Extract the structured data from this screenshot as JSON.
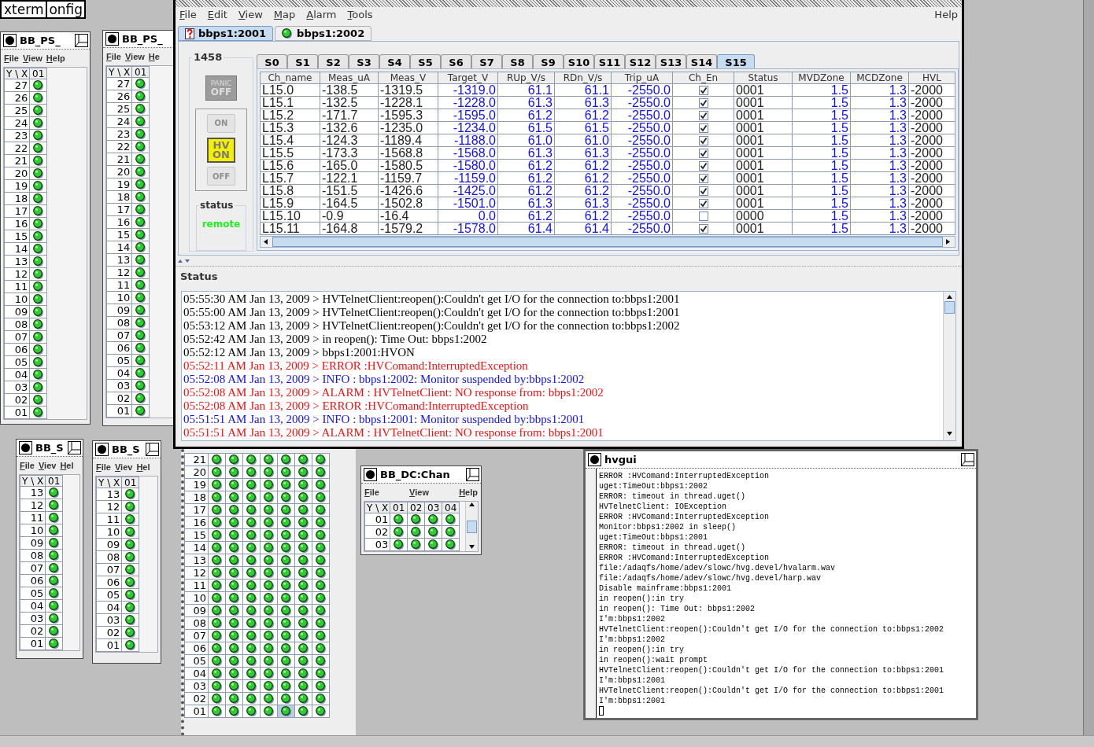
{
  "desktop_labels": [
    "xterm",
    "onfig"
  ],
  "grid_windows": [
    {
      "title": "BB_PS_",
      "menu": [
        "File",
        "View",
        "Help"
      ],
      "corner": "Y \\ X",
      "columns": [
        "01"
      ],
      "rows": [
        {
          "label": "27",
          "lit": [
            true
          ]
        },
        {
          "label": "26",
          "lit": [
            true
          ]
        },
        {
          "label": "25",
          "lit": [
            true
          ]
        },
        {
          "label": "24",
          "lit": [
            true
          ]
        },
        {
          "label": "23",
          "lit": [
            true
          ]
        },
        {
          "label": "22",
          "lit": [
            true
          ]
        },
        {
          "label": "21",
          "lit": [
            true
          ]
        },
        {
          "label": "20",
          "lit": [
            true
          ]
        },
        {
          "label": "19",
          "lit": [
            true
          ]
        },
        {
          "label": "18",
          "lit": [
            true
          ]
        },
        {
          "label": "17",
          "lit": [
            true
          ]
        },
        {
          "label": "16",
          "lit": [
            true
          ]
        },
        {
          "label": "15",
          "lit": [
            true
          ]
        },
        {
          "label": "14",
          "lit": [
            true
          ]
        },
        {
          "label": "13",
          "lit": [
            true
          ]
        },
        {
          "label": "12",
          "lit": [
            true
          ]
        },
        {
          "label": "11",
          "lit": [
            true
          ]
        },
        {
          "label": "10",
          "lit": [
            true
          ]
        },
        {
          "label": "09",
          "lit": [
            true
          ]
        },
        {
          "label": "08",
          "lit": [
            true
          ]
        },
        {
          "label": "07",
          "lit": [
            true
          ]
        },
        {
          "label": "06",
          "lit": [
            true
          ]
        },
        {
          "label": "05",
          "lit": [
            true
          ]
        },
        {
          "label": "04",
          "lit": [
            true
          ]
        },
        {
          "label": "03",
          "lit": [
            true
          ]
        },
        {
          "label": "02",
          "lit": [
            true
          ]
        },
        {
          "label": "01",
          "lit": [
            true
          ]
        }
      ]
    },
    {
      "title": "BB_PS_",
      "menu": [
        "File",
        "View",
        "He"
      ],
      "corner": "Y \\ X",
      "columns": [
        "01"
      ],
      "rows": [
        {
          "label": "27",
          "lit": [
            true
          ]
        },
        {
          "label": "26",
          "lit": [
            true
          ]
        },
        {
          "label": "25",
          "lit": [
            true
          ]
        },
        {
          "label": "24",
          "lit": [
            true
          ]
        },
        {
          "label": "23",
          "lit": [
            true
          ]
        },
        {
          "label": "22",
          "lit": [
            true
          ]
        },
        {
          "label": "21",
          "lit": [
            true
          ]
        },
        {
          "label": "20",
          "lit": [
            true
          ]
        },
        {
          "label": "19",
          "lit": [
            true
          ]
        },
        {
          "label": "18",
          "lit": [
            true
          ]
        },
        {
          "label": "17",
          "lit": [
            true
          ]
        },
        {
          "label": "16",
          "lit": [
            true
          ]
        },
        {
          "label": "15",
          "lit": [
            true
          ]
        },
        {
          "label": "14",
          "lit": [
            true
          ]
        },
        {
          "label": "13",
          "lit": [
            true
          ]
        },
        {
          "label": "12",
          "lit": [
            true
          ]
        },
        {
          "label": "11",
          "lit": [
            true
          ]
        },
        {
          "label": "10",
          "lit": [
            true
          ]
        },
        {
          "label": "09",
          "lit": [
            true
          ]
        },
        {
          "label": "08",
          "lit": [
            true
          ]
        },
        {
          "label": "07",
          "lit": [
            true
          ]
        },
        {
          "label": "06",
          "lit": [
            true
          ]
        },
        {
          "label": "05",
          "lit": [
            true
          ]
        },
        {
          "label": "04",
          "lit": [
            true
          ]
        },
        {
          "label": "03",
          "lit": [
            true
          ]
        },
        {
          "label": "02",
          "lit": [
            true
          ]
        },
        {
          "label": "01",
          "lit": [
            true
          ]
        }
      ]
    },
    {
      "title": "BB_S",
      "menu": [
        "File",
        "Viev",
        "Hel"
      ],
      "corner": "Y \\ X",
      "columns": [
        "01"
      ],
      "rows": [
        {
          "label": "13",
          "lit": [
            true
          ]
        },
        {
          "label": "12",
          "lit": [
            true
          ]
        },
        {
          "label": "11",
          "lit": [
            true
          ]
        },
        {
          "label": "10",
          "lit": [
            true
          ]
        },
        {
          "label": "09",
          "lit": [
            true
          ]
        },
        {
          "label": "08",
          "lit": [
            true
          ]
        },
        {
          "label": "07",
          "lit": [
            true
          ]
        },
        {
          "label": "06",
          "lit": [
            true
          ]
        },
        {
          "label": "05",
          "lit": [
            true
          ]
        },
        {
          "label": "04",
          "lit": [
            true
          ]
        },
        {
          "label": "03",
          "lit": [
            true
          ]
        },
        {
          "label": "02",
          "lit": [
            true
          ]
        },
        {
          "label": "01",
          "lit": [
            true
          ]
        }
      ]
    },
    {
      "title": "BB_S",
      "menu": [
        "File",
        "Viev",
        "Hel"
      ],
      "corner": "Y \\ X",
      "columns": [
        "01"
      ],
      "rows": [
        {
          "label": "13",
          "lit": [
            true
          ]
        },
        {
          "label": "12",
          "lit": [
            true
          ]
        },
        {
          "label": "11",
          "lit": [
            true
          ]
        },
        {
          "label": "10",
          "lit": [
            true
          ]
        },
        {
          "label": "09",
          "lit": [
            true
          ]
        },
        {
          "label": "08",
          "lit": [
            true
          ]
        },
        {
          "label": "07",
          "lit": [
            true
          ]
        },
        {
          "label": "06",
          "lit": [
            true
          ]
        },
        {
          "label": "05",
          "lit": [
            true
          ]
        },
        {
          "label": "04",
          "lit": [
            true
          ]
        },
        {
          "label": "03",
          "lit": [
            true
          ]
        },
        {
          "label": "02",
          "lit": [
            true
          ]
        },
        {
          "label": "01",
          "lit": [
            true
          ]
        }
      ]
    },
    {
      "title": "BB_DC:Chan",
      "menu": [
        "File",
        "View",
        "Help"
      ],
      "corner": "Y \\ X",
      "columns": [
        "01",
        "02",
        "03",
        "04"
      ],
      "rows": [
        {
          "label": "01",
          "lit": [
            true,
            true,
            true,
            true
          ]
        },
        {
          "label": "02",
          "lit": [
            true,
            true,
            true,
            true
          ]
        },
        {
          "label": "03",
          "lit": [
            true,
            true,
            true,
            true
          ]
        }
      ]
    }
  ],
  "big_grid": {
    "rows": [
      {
        "label": "21",
        "lit": [
          true,
          true,
          true,
          true,
          true,
          true,
          true
        ],
        "selected": [
          false,
          false,
          false,
          false,
          false,
          false,
          false
        ]
      },
      {
        "label": "20",
        "lit": [
          true,
          true,
          true,
          true,
          true,
          true,
          true
        ],
        "selected": [
          false,
          false,
          false,
          false,
          false,
          false,
          false
        ]
      },
      {
        "label": "19",
        "lit": [
          true,
          true,
          true,
          true,
          true,
          true,
          true
        ],
        "selected": [
          false,
          false,
          false,
          false,
          false,
          false,
          false
        ]
      },
      {
        "label": "18",
        "lit": [
          true,
          true,
          true,
          true,
          true,
          true,
          true
        ],
        "selected": [
          false,
          false,
          false,
          false,
          false,
          false,
          false
        ]
      },
      {
        "label": "17",
        "lit": [
          true,
          true,
          true,
          true,
          true,
          true,
          true
        ],
        "selected": [
          false,
          false,
          false,
          false,
          false,
          false,
          false
        ]
      },
      {
        "label": "16",
        "lit": [
          true,
          true,
          true,
          true,
          true,
          true,
          true
        ],
        "selected": [
          false,
          false,
          false,
          false,
          false,
          false,
          false
        ]
      },
      {
        "label": "15",
        "lit": [
          true,
          true,
          true,
          true,
          true,
          true,
          true
        ],
        "selected": [
          false,
          false,
          false,
          false,
          false,
          false,
          false
        ]
      },
      {
        "label": "14",
        "lit": [
          true,
          true,
          true,
          true,
          true,
          true,
          true
        ],
        "selected": [
          false,
          false,
          false,
          false,
          false,
          false,
          false
        ]
      },
      {
        "label": "13",
        "lit": [
          true,
          true,
          true,
          true,
          true,
          true,
          true
        ],
        "selected": [
          false,
          false,
          false,
          false,
          false,
          false,
          false
        ]
      },
      {
        "label": "12",
        "lit": [
          true,
          true,
          true,
          true,
          true,
          true,
          true
        ],
        "selected": [
          false,
          false,
          false,
          false,
          false,
          false,
          false
        ]
      },
      {
        "label": "11",
        "lit": [
          true,
          true,
          true,
          true,
          true,
          true,
          true
        ],
        "selected": [
          false,
          false,
          false,
          false,
          false,
          false,
          false
        ]
      },
      {
        "label": "10",
        "lit": [
          true,
          true,
          true,
          true,
          true,
          true,
          true
        ],
        "selected": [
          false,
          false,
          false,
          false,
          false,
          false,
          false
        ]
      },
      {
        "label": "09",
        "lit": [
          true,
          true,
          true,
          true,
          true,
          true,
          true
        ],
        "selected": [
          false,
          false,
          false,
          false,
          false,
          false,
          false
        ]
      },
      {
        "label": "08",
        "lit": [
          true,
          true,
          true,
          true,
          true,
          true,
          true
        ],
        "selected": [
          false,
          false,
          false,
          false,
          false,
          false,
          false
        ]
      },
      {
        "label": "07",
        "lit": [
          true,
          true,
          true,
          true,
          true,
          true,
          true
        ],
        "selected": [
          false,
          false,
          false,
          false,
          false,
          false,
          false
        ]
      },
      {
        "label": "06",
        "lit": [
          true,
          true,
          true,
          true,
          true,
          true,
          true
        ],
        "selected": [
          false,
          false,
          false,
          false,
          false,
          false,
          false
        ]
      },
      {
        "label": "05",
        "lit": [
          true,
          true,
          true,
          true,
          true,
          true,
          true
        ],
        "selected": [
          false,
          false,
          false,
          false,
          false,
          false,
          false
        ]
      },
      {
        "label": "04",
        "lit": [
          true,
          true,
          true,
          true,
          true,
          true,
          true
        ],
        "selected": [
          false,
          false,
          false,
          false,
          false,
          false,
          false
        ]
      },
      {
        "label": "03",
        "lit": [
          true,
          true,
          true,
          true,
          true,
          true,
          true
        ],
        "selected": [
          false,
          false,
          false,
          false,
          false,
          false,
          false
        ]
      },
      {
        "label": "02",
        "lit": [
          true,
          true,
          true,
          true,
          true,
          true,
          true
        ],
        "selected": [
          false,
          false,
          false,
          false,
          false,
          false,
          false
        ]
      },
      {
        "label": "01",
        "lit": [
          true,
          true,
          true,
          true,
          true,
          true,
          true
        ],
        "selected": [
          false,
          false,
          false,
          false,
          true,
          false,
          false
        ]
      }
    ]
  },
  "main": {
    "menu": [
      "File",
      "Edit",
      "View",
      "Map",
      "Alarm",
      "Tools"
    ],
    "menu_right": "Help",
    "crates": [
      {
        "label": "bbps1:2001",
        "kind": "question",
        "selected": true
      },
      {
        "label": "bbps1:2002",
        "kind": "led",
        "selected": false
      }
    ],
    "crate_panel": {
      "title": "1458",
      "panic": [
        "PANIC",
        "OFF"
      ],
      "on_button": {
        "label": "ON",
        "disabled": true
      },
      "hv_button": {
        "lines": [
          "HV",
          "ON"
        ],
        "active": true
      },
      "off_button": {
        "label": "OFF",
        "disabled": true
      },
      "status_title": "status",
      "status_value": "remote"
    },
    "slots": [
      {
        "label": "S0",
        "selected": false
      },
      {
        "label": "S1",
        "selected": false
      },
      {
        "label": "S2",
        "selected": false
      },
      {
        "label": "S3",
        "selected": false
      },
      {
        "label": "S4",
        "selected": false
      },
      {
        "label": "S5",
        "selected": false
      },
      {
        "label": "S6",
        "selected": false
      },
      {
        "label": "S7",
        "selected": false
      },
      {
        "label": "S8",
        "selected": false
      },
      {
        "label": "S9",
        "selected": false
      },
      {
        "label": "S10",
        "selected": false
      },
      {
        "label": "S11",
        "selected": false
      },
      {
        "label": "S12",
        "selected": false
      },
      {
        "label": "S13",
        "selected": false
      },
      {
        "label": "S14",
        "selected": false
      },
      {
        "label": "S15",
        "selected": true
      }
    ],
    "table": {
      "columns": [
        {
          "label": "Ch_name",
          "kind": "readonly"
        },
        {
          "label": "Meas_uA",
          "kind": "readonly"
        },
        {
          "label": "Meas_V",
          "kind": "readonly"
        },
        {
          "label": "Target_V",
          "kind": "editable"
        },
        {
          "label": "RUp_V/s",
          "kind": "editable"
        },
        {
          "label": "RDn_V/s",
          "kind": "editable"
        },
        {
          "label": "Trip_uA",
          "kind": "editable"
        },
        {
          "label": "Ch_En",
          "kind": "check"
        },
        {
          "label": "Status",
          "kind": "readonly"
        },
        {
          "label": "MVDZone",
          "kind": "editable"
        },
        {
          "label": "MCDZone",
          "kind": "editable"
        },
        {
          "label": "HVL",
          "kind": "readonly"
        }
      ],
      "rows": [
        {
          "cells": [
            "L15.0",
            "-138.5",
            "-1319.5",
            "-1319.0",
            "61.1",
            "61.1",
            "-2550.0",
            null,
            "0001",
            "1.5",
            "1.3",
            "-2000"
          ],
          "enabled": true
        },
        {
          "cells": [
            "L15.1",
            "-132.5",
            "-1228.1",
            "-1228.0",
            "61.3",
            "61.3",
            "-2550.0",
            null,
            "0001",
            "1.5",
            "1.3",
            "-2000"
          ],
          "enabled": true
        },
        {
          "cells": [
            "L15.2",
            "-171.7",
            "-1595.3",
            "-1595.0",
            "61.2",
            "61.2",
            "-2550.0",
            null,
            "0001",
            "1.5",
            "1.3",
            "-2000"
          ],
          "enabled": true
        },
        {
          "cells": [
            "L15.3",
            "-132.6",
            "-1235.0",
            "-1234.0",
            "61.5",
            "61.5",
            "-2550.0",
            null,
            "0001",
            "1.5",
            "1.3",
            "-2000"
          ],
          "enabled": true
        },
        {
          "cells": [
            "L15.4",
            "-124.3",
            "-1189.4",
            "-1188.0",
            "61.0",
            "61.0",
            "-2550.0",
            null,
            "0001",
            "1.5",
            "1.3",
            "-2000"
          ],
          "enabled": true
        },
        {
          "cells": [
            "L15.5",
            "-173.3",
            "-1568.8",
            "-1568.0",
            "61.3",
            "61.3",
            "-2550.0",
            null,
            "0001",
            "1.5",
            "1.3",
            "-2000"
          ],
          "enabled": true
        },
        {
          "cells": [
            "L15.6",
            "-165.0",
            "-1580.5",
            "-1580.0",
            "61.2",
            "61.2",
            "-2550.0",
            null,
            "0001",
            "1.5",
            "1.3",
            "-2000"
          ],
          "enabled": true
        },
        {
          "cells": [
            "L15.7",
            "-122.1",
            "-1159.7",
            "-1159.0",
            "61.2",
            "61.2",
            "-2550.0",
            null,
            "0001",
            "1.5",
            "1.3",
            "-2000"
          ],
          "enabled": true
        },
        {
          "cells": [
            "L15.8",
            "-151.5",
            "-1426.6",
            "-1425.0",
            "61.2",
            "61.2",
            "-2550.0",
            null,
            "0001",
            "1.5",
            "1.3",
            "-2000"
          ],
          "enabled": true
        },
        {
          "cells": [
            "L15.9",
            "-164.5",
            "-1502.8",
            "-1501.0",
            "61.3",
            "61.3",
            "-2550.0",
            null,
            "0001",
            "1.5",
            "1.3",
            "-2000"
          ],
          "enabled": true
        },
        {
          "cells": [
            "L15.10",
            "-0.9",
            "-16.4",
            "0.0",
            "61.2",
            "61.2",
            "-2550.0",
            null,
            "0000",
            "1.5",
            "1.3",
            "-2000"
          ],
          "enabled": false
        },
        {
          "cells": [
            "L15.11",
            "-164.8",
            "-1579.2",
            "-1578.0",
            "61.4",
            "61.4",
            "-2550.0",
            null,
            "0001",
            "1.5",
            "1.3",
            "-2000"
          ],
          "enabled": true
        }
      ]
    },
    "log_title": "Status",
    "log": [
      {
        "kind": "plain",
        "text": "05:55:30 AM Jan 13, 2009 > HVTelnetClient:reopen():Couldn't get I/O for the connection to:bbps1:2001"
      },
      {
        "kind": "plain",
        "text": "05:55:00 AM Jan 13, 2009 > HVTelnetClient:reopen():Couldn't get I/O for the connection to:bbps1:2001"
      },
      {
        "kind": "plain",
        "text": "05:53:12 AM Jan 13, 2009 > HVTelnetClient:reopen():Couldn't get I/O for the connection to:bbps1:2002"
      },
      {
        "kind": "plain",
        "text": "05:52:42 AM Jan 13, 2009 > in reopen(): Time Out: bbps1:2002"
      },
      {
        "kind": "plain",
        "text": "05:52:12 AM Jan 13, 2009 > bbps1:2001:HVON"
      },
      {
        "kind": "error",
        "text": "05:52:11 AM Jan 13, 2009 > ERROR :HVComand:InterruptedException"
      },
      {
        "kind": "info",
        "text": "05:52:08 AM Jan 13, 2009 > INFO : bbps1:2002: Monitor suspended by:bbps1:2002"
      },
      {
        "kind": "alarm",
        "text": "05:52:08 AM Jan 13, 2009 > ALARM : HVTelnetClient: NO response from: bbps1:2002"
      },
      {
        "kind": "error",
        "text": "05:52:08 AM Jan 13, 2009 > ERROR :HVComand:InterruptedException"
      },
      {
        "kind": "info",
        "text": "05:51:51 AM Jan 13, 2009 > INFO : bbps1:2001: Monitor suspended by:bbps1:2001"
      },
      {
        "kind": "alarm",
        "text": "05:51:51 AM Jan 13, 2009 > ALARM : HVTelnetClient: NO response from: bbps1:2001"
      }
    ]
  },
  "hvgui": {
    "title": "hvgui",
    "lines": [
      "ERROR :HVComand:InterruptedException",
      "uget:TimeOut:bbps1:2002",
      "ERROR: timeout in thread.uget()",
      "HVTelnetClient: IOException",
      "ERROR :HVComand:InterruptedException",
      "Monitor:bbps1:2002 in sleep()",
      "uget:TimeOut:bbps1:2001",
      "ERROR: timeout in thread.uget()",
      "ERROR :HVComand:InterruptedException",
      "file:/adaqfs/home/adev/slowc/hvg.devel/hvalarm.wav",
      "file:/adaqfs/home/adev/slowc/hvg.devel/harp.wav",
      "Disable mainframe:bbps1:2001",
      "in reopen():in try",
      "in reopen(): Time Out: bbps1:2002",
      "I'm:bbps1:2002",
      "HVTelnetClient:reopen():Couldn't get I/O for the connection to:bbps1:2002",
      "I'm:bbps1:2002",
      "in reopen():in try",
      "in reopen():wait prompt",
      "HVTelnetClient:reopen():Couldn't get I/O for the connection to:bbps1:2001",
      "I'm:bbps1:2001",
      "HVTelnetClient:reopen():Couldn't get I/O for the connection to:bbps1:2001",
      "I'm:bbps1:2001"
    ]
  }
}
